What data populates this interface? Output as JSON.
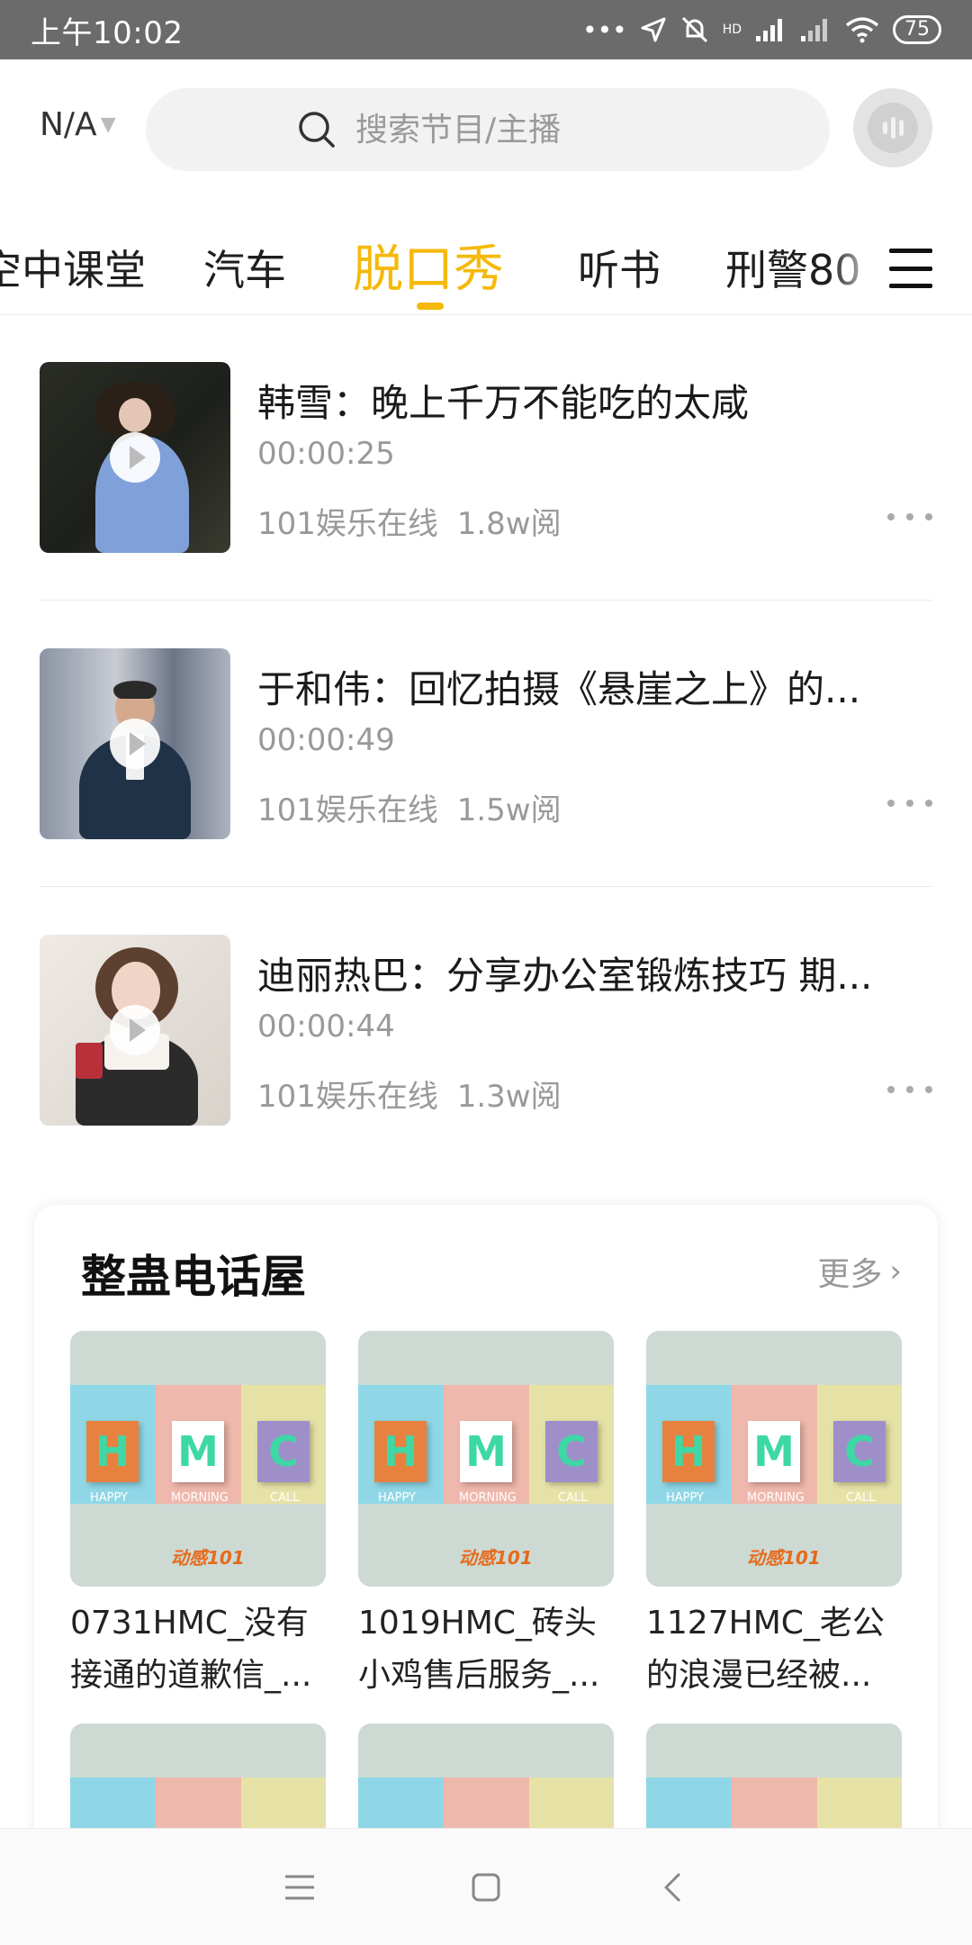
{
  "status_bar": {
    "time": "上午10:02",
    "battery": "75",
    "network_label": "HD"
  },
  "header": {
    "location": "N/A",
    "search_placeholder": "搜索节目/主播"
  },
  "tabs": [
    {
      "label": "空中课堂",
      "active": false
    },
    {
      "label": "汽车",
      "active": false
    },
    {
      "label": "脱口秀",
      "active": true
    },
    {
      "label": "听书",
      "active": false
    },
    {
      "label": "刑警80",
      "active": false
    }
  ],
  "programs": [
    {
      "title": "韩雪：晚上千万不能吃的太咸",
      "duration": "00:00:25",
      "source": "101娱乐在线",
      "views": "1.8w阅"
    },
    {
      "title": "于和伟：回忆拍摄《悬崖之上》的...",
      "duration": "00:00:49",
      "source": "101娱乐在线",
      "views": "1.5w阅"
    },
    {
      "title": "迪丽热巴：分享办公室锻炼技巧 期...",
      "duration": "00:00:44",
      "source": "101娱乐在线",
      "views": "1.3w阅"
    }
  ],
  "section": {
    "title": "整蛊电话屋",
    "more_label": "更多",
    "albums": [
      {
        "title": "0731HMC_没有接通的道歉信_..."
      },
      {
        "title": "1019HMC_砖头小鸡售后服务_..."
      },
      {
        "title": "1127HMC_老公的浪漫已经被..."
      }
    ],
    "cover_letters": [
      "H",
      "M",
      "C"
    ],
    "cover_words": [
      "HAPPY",
      "MORNING",
      "CALL"
    ],
    "cover_logo": "动感101"
  },
  "colors": {
    "accent": "#f5b90a",
    "status_bar": "#6b6b6b"
  }
}
